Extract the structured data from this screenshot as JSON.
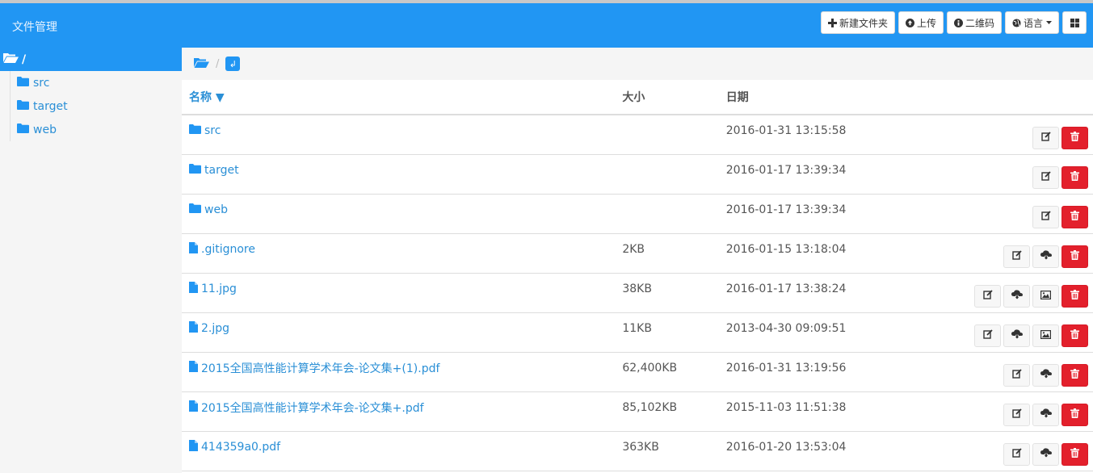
{
  "app": {
    "title": "文件管理"
  },
  "toolbar": {
    "new_folder": "新建文件夹",
    "upload": "上传",
    "qrcode": "二维码",
    "language": "语言"
  },
  "sidebar": {
    "root_label": "/",
    "items": [
      {
        "label": "src"
      },
      {
        "label": "target"
      },
      {
        "label": "web"
      }
    ]
  },
  "breadcrumb": {
    "separator": "/",
    "up_glyph": "↲"
  },
  "table": {
    "headers": {
      "name": "名称 ▼",
      "size": "大小",
      "date": "日期"
    },
    "rows": [
      {
        "type": "folder",
        "name": "src",
        "size": "",
        "date": "2016-01-31 13:15:58",
        "actions": [
          "edit",
          "delete"
        ]
      },
      {
        "type": "folder",
        "name": "target",
        "size": "",
        "date": "2016-01-17 13:39:34",
        "actions": [
          "edit",
          "delete"
        ]
      },
      {
        "type": "folder",
        "name": "web",
        "size": "",
        "date": "2016-01-17 13:39:34",
        "actions": [
          "edit",
          "delete"
        ]
      },
      {
        "type": "file",
        "name": ".gitignore",
        "size": "2KB",
        "date": "2016-01-15 13:18:04",
        "actions": [
          "edit",
          "download",
          "delete"
        ]
      },
      {
        "type": "file",
        "name": "11.jpg",
        "size": "38KB",
        "date": "2016-01-17 13:38:24",
        "actions": [
          "edit",
          "download",
          "image",
          "delete"
        ]
      },
      {
        "type": "file",
        "name": "2.jpg",
        "size": "11KB",
        "date": "2013-04-30 09:09:51",
        "actions": [
          "edit",
          "download",
          "image",
          "delete"
        ]
      },
      {
        "type": "file",
        "name": "2015全国高性能计算学术年会-论文集+(1).pdf",
        "size": "62,400KB",
        "date": "2016-01-31 13:19:56",
        "actions": [
          "edit",
          "download",
          "delete"
        ]
      },
      {
        "type": "file",
        "name": "2015全国高性能计算学术年会-论文集+.pdf",
        "size": "85,102KB",
        "date": "2015-11-03 11:51:38",
        "actions": [
          "edit",
          "download",
          "delete"
        ]
      },
      {
        "type": "file",
        "name": "414359a0.pdf",
        "size": "363KB",
        "date": "2016-01-20 13:53:04",
        "actions": [
          "edit",
          "download",
          "delete"
        ]
      }
    ]
  },
  "colors": {
    "primary": "#2196f3",
    "link": "#2a8fd6",
    "danger": "#e3202c"
  }
}
